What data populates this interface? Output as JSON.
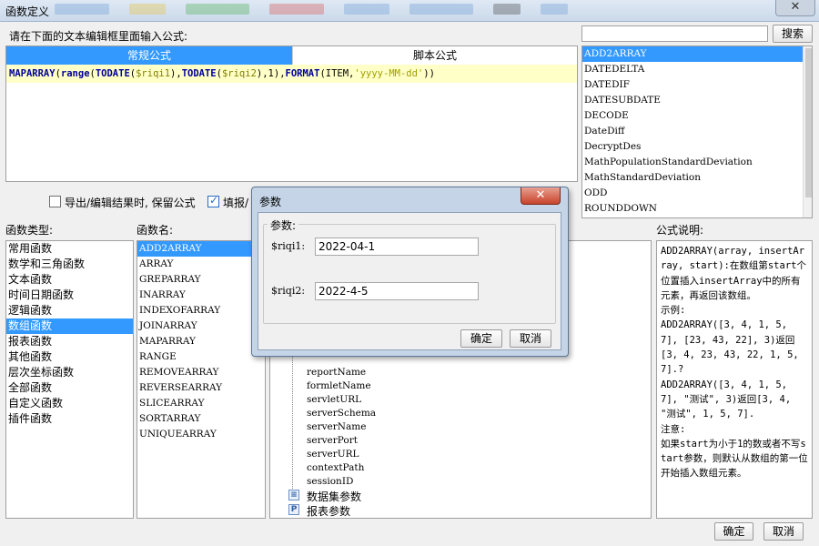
{
  "window": {
    "title": "函数定义",
    "close_glyph": "✕"
  },
  "editor": {
    "prompt": "请在下面的文本编辑框里面输入公式:",
    "tabs": [
      {
        "label": "常规公式",
        "active": true
      },
      {
        "label": "脚本公式",
        "active": false
      }
    ],
    "formula_parts": [
      "MAPARRAY",
      "(",
      "range",
      "(",
      "TODATE",
      "(",
      "$riqi1",
      "),",
      "TODATE",
      "(",
      "$riqi2",
      "),1),",
      "FORMAT",
      "(ITEM,",
      "'yyyy-MM-dd'",
      "))"
    ]
  },
  "search": {
    "placeholder": "",
    "button_label": "搜索"
  },
  "function_search_list": {
    "items": [
      "ADD2ARRAY",
      "DATEDELTA",
      "DATEDIF",
      "DATESUBDATE",
      "DECODE",
      "DateDiff",
      "DecryptDes",
      "MathPopulationStandardDeviation",
      "MathStandardDeviation",
      "ODD",
      "ROUNDDOWN"
    ],
    "selected_index": 0
  },
  "options": {
    "keep_formula_label": "导出/编辑结果时, 保留公式",
    "keep_formula_checked": false,
    "fill_label": "填报/",
    "fill_checked": true
  },
  "categories": {
    "header": "函数类型:",
    "items": [
      "常用函数",
      "数学和三角函数",
      "文本函数",
      "时间日期函数",
      "逻辑函数",
      "数组函数",
      "报表函数",
      "其他函数",
      "层次坐标函数",
      "全部函数",
      "自定义函数",
      "插件函数"
    ],
    "selected_index": 5
  },
  "function_names": {
    "header": "函数名:",
    "items": [
      "ADD2ARRAY",
      "ARRAY",
      "GREPARRAY",
      "INARRAY",
      "INDEXOFARRAY",
      "JOINARRAY",
      "MAPARRAY",
      "RANGE",
      "REMOVEARRAY",
      "REVERSEARRAY",
      "SLICEARRAY",
      "SORTARRAY",
      "UNIQUEARRAY"
    ],
    "selected_index": 0
  },
  "param_tree": {
    "nodes": [
      "reportName",
      "formletName",
      "servletURL",
      "serverSchema",
      "serverName",
      "serverPort",
      "serverURL",
      "contextPath",
      "sessionID"
    ],
    "dataset_label": "数据集参数",
    "report_label": "报表参数"
  },
  "description": {
    "header": "公式说明:",
    "text": "ADD2ARRAY(array, insertArray, start):在数组第start个位置插入insertArray中的所有元素，再返回该数组。\n示例:\nADD2ARRAY([3, 4, 1, 5, 7], [23, 43, 22], 3)返回[3, 4, 23, 43, 22, 1, 5, 7].?\nADD2ARRAY([3, 4, 1, 5, 7], \"测试\", 3)返回[3, 4, \"测试\", 1, 5, 7].\n注意:\n如果start为小于1的数或者不写start参数，则默认从数组的第一位开始插入数组元素。"
  },
  "footer": {
    "ok_label": "确定",
    "cancel_label": "取消"
  },
  "param_dialog": {
    "title": "参数",
    "group_label": "参数:",
    "fields": [
      {
        "label": "$riqi1:",
        "value": "2022-04-1"
      },
      {
        "label": "$riqi2:",
        "value": "2022-4-5"
      }
    ],
    "ok_label": "确定",
    "cancel_label": "取消",
    "close_glyph": "✕"
  },
  "colors": {
    "selection": "#3399ff",
    "formula_bg": "#ffffc8",
    "keyword": "#00009c"
  }
}
